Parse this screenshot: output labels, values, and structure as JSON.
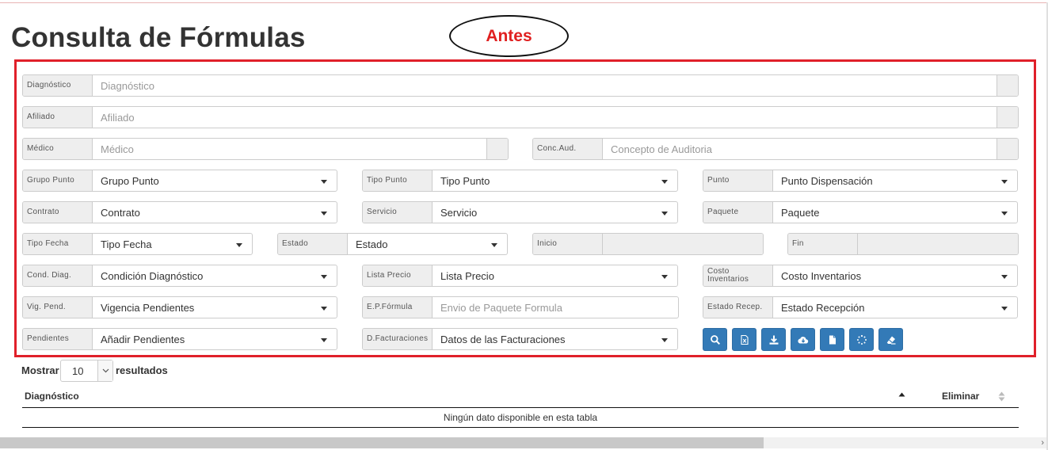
{
  "page": {
    "title": "Consulta de Fórmulas",
    "annotation": "Antes"
  },
  "form": {
    "diagnostico": {
      "label": "Diagnóstico",
      "placeholder": "Diagnóstico"
    },
    "afiliado": {
      "label": "Afiliado",
      "placeholder": "Afiliado"
    },
    "medico": {
      "label": "Médico",
      "placeholder": "Médico"
    },
    "conc_aud": {
      "label": "Conc.Aud.",
      "placeholder": "Concepto de Auditoria"
    },
    "grupo_punto": {
      "label": "Grupo Punto",
      "value": "Grupo Punto"
    },
    "tipo_punto": {
      "label": "Tipo Punto",
      "value": "Tipo Punto"
    },
    "punto": {
      "label": "Punto",
      "value": "Punto Dispensación"
    },
    "contrato": {
      "label": "Contrato",
      "value": "Contrato"
    },
    "servicio": {
      "label": "Servicio",
      "value": "Servicio"
    },
    "paquete": {
      "label": "Paquete",
      "value": "Paquete"
    },
    "tipo_fecha": {
      "label": "Tipo Fecha",
      "value": "Tipo Fecha"
    },
    "estado": {
      "label": "Estado",
      "value": "Estado"
    },
    "inicio": {
      "label": "Inicio",
      "value": ""
    },
    "fin": {
      "label": "Fin",
      "value": ""
    },
    "cond_diag": {
      "label": "Cond. Diag.",
      "value": "Condición Diagnóstico"
    },
    "lista_precio": {
      "label": "Lista Precio",
      "value": "Lista Precio"
    },
    "costo_inventarios": {
      "label": "Costo Inventarios",
      "value": "Costo Inventarios"
    },
    "vig_pend": {
      "label": "Vig. Pend.",
      "value": "Vigencia Pendientes"
    },
    "ep_formula": {
      "label": "E.P.Fórmula",
      "placeholder": "Envio de Paquete Formula"
    },
    "estado_recep": {
      "label": "Estado Recep.",
      "value": "Estado Recepción"
    },
    "pendientes": {
      "label": "Pendientes",
      "value": "Añadir Pendientes"
    },
    "d_facturaciones": {
      "label": "D.Facturaciones",
      "value": "Datos de las Facturaciones"
    }
  },
  "toolbar": {
    "buttons": [
      {
        "icon": "search-icon"
      },
      {
        "icon": "excel-file-icon"
      },
      {
        "icon": "download-icon"
      },
      {
        "icon": "cloud-download-icon"
      },
      {
        "icon": "document-icon"
      },
      {
        "icon": "spinner-icon"
      },
      {
        "icon": "eraser-icon"
      }
    ],
    "color": "#337ab7"
  },
  "table": {
    "length_prefix": "Mostrar",
    "length_value": "10",
    "length_suffix": "resultados",
    "columns": [
      "Diagnóstico",
      "Eliminar"
    ],
    "empty_text": "Ningún dato disponible en esta tabla"
  },
  "colors": {
    "frame": "#e0202a",
    "annotation": "#e02020"
  }
}
